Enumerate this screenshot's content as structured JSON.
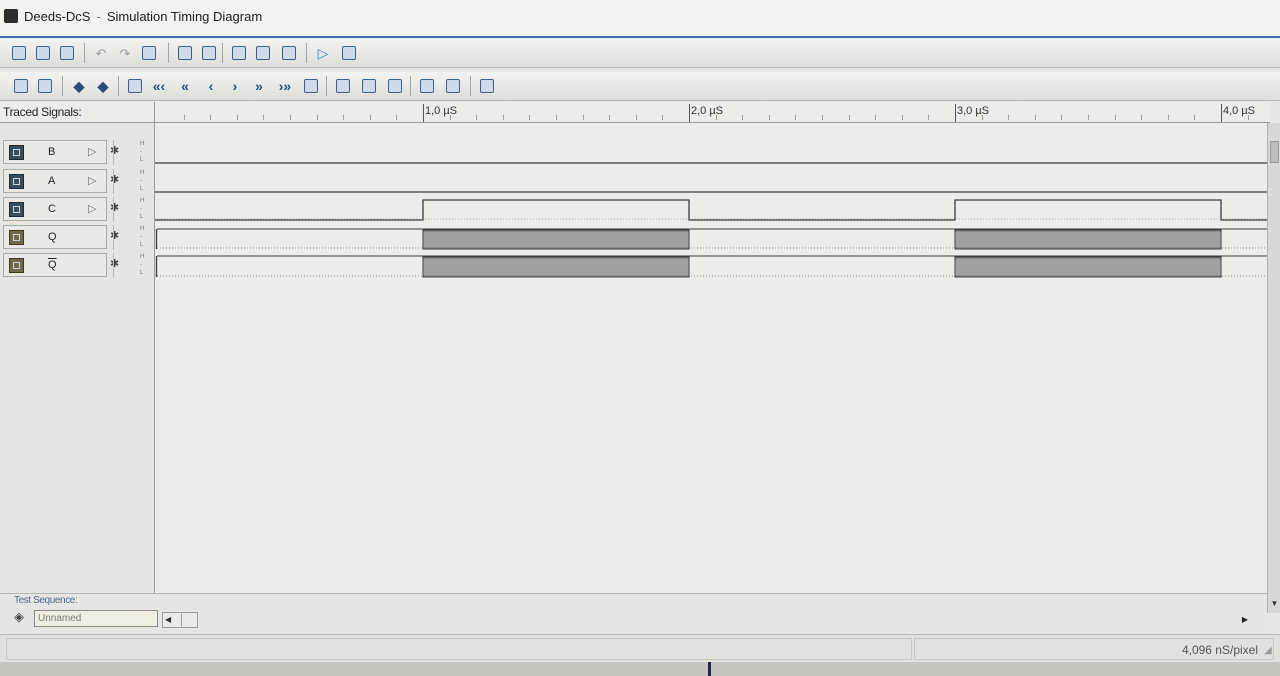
{
  "window": {
    "app_name": "Deeds-DcS",
    "separator": "-",
    "title": "Simulation Timing Diagram",
    "app_icon": "chip-icon"
  },
  "toolbar1": {
    "tools": [
      {
        "name": "new-diagram-icon"
      },
      {
        "name": "open-icon"
      },
      {
        "name": "close-file-icon"
      },
      {
        "name": "undo-icon"
      },
      {
        "name": "redo-icon"
      },
      {
        "name": "print-icon"
      },
      {
        "name": "export-icon"
      },
      {
        "name": "settings-grid-icon"
      },
      {
        "name": "add-signal-icon"
      },
      {
        "name": "remove-signal-icon"
      },
      {
        "name": "find-signal-icon"
      },
      {
        "name": "run-simulation-icon"
      },
      {
        "name": "stop-simulation-icon"
      }
    ]
  },
  "toolbar2": {
    "tools": [
      {
        "name": "select-signal-icon"
      },
      {
        "name": "grid-toggle-icon"
      },
      {
        "name": "previous-edge-icon",
        "glyph": "◆"
      },
      {
        "name": "next-edge-icon",
        "glyph": "◆"
      },
      {
        "name": "go-start-icon"
      },
      {
        "name": "fast-back-icon",
        "glyph": "«‹"
      },
      {
        "name": "back-icon",
        "glyph": "«"
      },
      {
        "name": "step-back-icon",
        "glyph": "‹"
      },
      {
        "name": "step-forward-icon",
        "glyph": "›"
      },
      {
        "name": "forward-icon",
        "glyph": "»"
      },
      {
        "name": "fast-forward-icon",
        "glyph": "›»"
      },
      {
        "name": "go-end-icon"
      },
      {
        "name": "zoom-in-icon"
      },
      {
        "name": "zoom-out-icon"
      },
      {
        "name": "zoom-fit-icon"
      },
      {
        "name": "marker-add-icon"
      },
      {
        "name": "marker-remove-icon"
      },
      {
        "name": "options-icon"
      }
    ]
  },
  "header": {
    "traced_signals_label": "Traced Signals:"
  },
  "ruler": {
    "labels": [
      "1,0 µS",
      "2,0 µS",
      "3,0 µS",
      "4,0 µS"
    ],
    "label_times_us": [
      1.0,
      2.0,
      3.0,
      4.0
    ]
  },
  "signals": [
    {
      "name": "B",
      "type": "input",
      "probe": "▷",
      "hl": "H\nL"
    },
    {
      "name": "A",
      "type": "input",
      "probe": "▷",
      "hl": "H\nL"
    },
    {
      "name": "C",
      "type": "input",
      "probe": "▷",
      "hl": "H\nL"
    },
    {
      "name": "Q",
      "type": "output",
      "probe": "",
      "hl": "H\nL"
    },
    {
      "name": "Q",
      "overline": true,
      "type": "output",
      "probe": "",
      "hl": "H\nL"
    }
  ],
  "waveforms": {
    "time_range_us": [
      0,
      4.15
    ],
    "B": {
      "level": "low"
    },
    "A": {
      "level": "low"
    },
    "C": {
      "high_intervals_us": [
        [
          1.0,
          2.0
        ],
        [
          3.0,
          4.0
        ]
      ]
    },
    "Q": {
      "oscillating_intervals_us": [
        [
          1.0,
          2.0
        ],
        [
          3.0,
          4.0
        ]
      ]
    },
    "Q_bar": {
      "oscillating_intervals_us": [
        [
          1.0,
          2.0
        ],
        [
          3.0,
          4.0
        ]
      ]
    }
  },
  "test_sequence": {
    "label": "Test Sequence:",
    "value": "Unnamed",
    "icon": "tag-icon"
  },
  "statusbar": {
    "resolution": "4,096 nS/pixel"
  },
  "colors": {
    "title_accent": "#3f6fb0",
    "wave_line": "#3b3b3b",
    "oscillation_fill": "#8c8c8c",
    "dotted_low": "#6b6b6b"
  }
}
